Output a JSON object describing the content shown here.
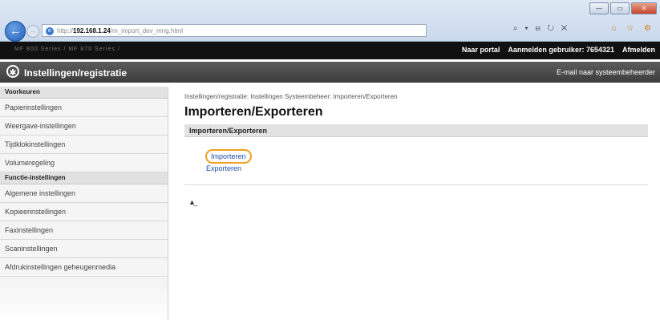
{
  "browser": {
    "window_buttons": [
      "—",
      "▭",
      "✕"
    ],
    "back_icon": "back-arrow-icon",
    "address_url_prefix": "http://",
    "address_host": "192.168.1.24",
    "address_path": "/m_import_dev_mng.html",
    "tools_text": "⌕ ▾ ⊟ ↻ ✕",
    "right_icons": "⌂ ☆ ⚙"
  },
  "topbar": {
    "device_name": "MF 800 Series / MF 870 Series /",
    "portal_link": "Naar portal",
    "login_user": "Aanmelden gebruiker: 7654321",
    "logout_link": "Afmelden"
  },
  "header": {
    "title": "Instellingen/registratie",
    "email_link": "E-mail naar systeembeheerder"
  },
  "sidebar": {
    "sections": [
      {
        "heading": "Voorkeuren",
        "items": [
          "Papierinstellingen",
          "Weergave-instellingen",
          "Tijdklokinstellingen",
          "Volumeregeling"
        ]
      },
      {
        "heading": "Functie-instellingen",
        "items": [
          "Algemene instellingen",
          "Kopieerinstellingen",
          "Faxinstellingen",
          "Scaninstellingen",
          "Afdrukinstellingen geheugenmedia"
        ]
      }
    ]
  },
  "main": {
    "breadcrumb": "Instellingen/registratie: Instellingen Systeembeheer: Importeren/Exporteren",
    "page_title": "Importeren/Exporteren",
    "section_title": "Importeren/Exporteren",
    "import_link": "Importeren",
    "export_link": "Exporteren",
    "to_top_icon": "to-top-icon"
  }
}
